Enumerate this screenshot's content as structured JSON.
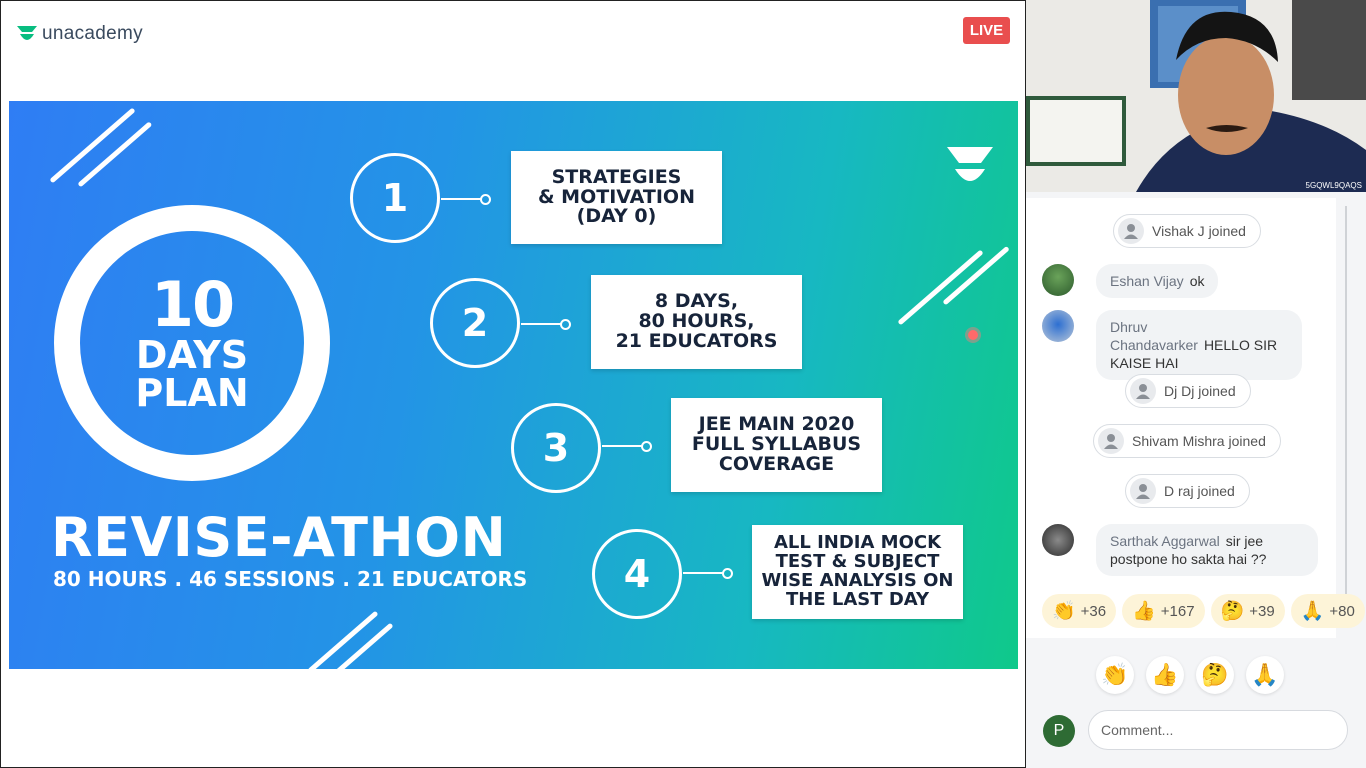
{
  "header": {
    "brand": "unacademy",
    "live_label": "LIVE"
  },
  "slide": {
    "ring_number": "10",
    "ring_word1": "DAYS",
    "ring_word2": "PLAN",
    "title": "REVISE-ATHON",
    "subtitle": "80 HOURS . 46 SESSIONS . 21 EDUCATORS",
    "steps": [
      {
        "num": "1",
        "text": "STRATEGIES\n& MOTIVATION\n(DAY 0)"
      },
      {
        "num": "2",
        "text": "8 DAYS,\n80 HOURS,\n21 EDUCATORS"
      },
      {
        "num": "3",
        "text": "JEE MAIN 2020\nFULL SYLLABUS\nCOVERAGE"
      },
      {
        "num": "4",
        "text": "ALL INDIA MOCK\nTEST & SUBJECT\nWISE ANALYSIS ON\nTHE LAST DAY"
      }
    ]
  },
  "video": {
    "tag": "5GQWL9QAQS"
  },
  "chat": {
    "joined": [
      {
        "name": "Vishak J",
        "suffix": "joined"
      },
      {
        "name": "Dj Dj",
        "suffix": "joined"
      },
      {
        "name": "Shivam Mishra",
        "suffix": "joined"
      },
      {
        "name": "D raj",
        "suffix": "joined"
      }
    ],
    "messages": [
      {
        "name": "Eshan Vijay",
        "text": "ok"
      },
      {
        "name": "Dhruv Chandavarker",
        "text": "HELLO SIR KAISE HAI"
      },
      {
        "name": "Sarthak Aggarwal",
        "text": "sir jee postpone ho sakta hai ??"
      }
    ]
  },
  "reactions": [
    {
      "icon": "👏",
      "count": "+36"
    },
    {
      "icon": "👍",
      "count": "+167"
    },
    {
      "icon": "🤔",
      "count": "+39"
    },
    {
      "icon": "🙏",
      "count": "+80"
    }
  ],
  "reaction_buttons": [
    "👏",
    "👍",
    "🤔",
    "🙏"
  ],
  "user": {
    "initial": "P"
  },
  "comment": {
    "placeholder": "Comment..."
  },
  "colors": {
    "live": "#e94e4e",
    "brand": "#08bd80",
    "avatar": "#2e6b34"
  }
}
